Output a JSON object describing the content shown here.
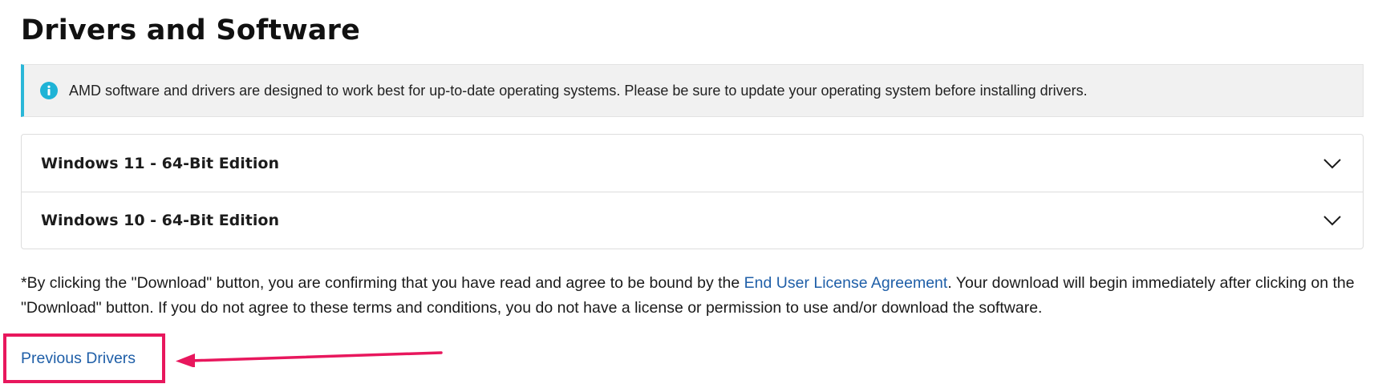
{
  "page": {
    "title": "Drivers and Software"
  },
  "info_banner": {
    "icon": "info-icon",
    "text": "AMD software and drivers are designed to work best for up-to-date operating systems. Please be sure to update your operating system before installing drivers."
  },
  "accordion": {
    "items": [
      {
        "label": "Windows 11 - 64-Bit Edition",
        "icon": "chevron-down-icon",
        "expanded": false
      },
      {
        "label": "Windows 10 - 64-Bit Edition",
        "icon": "chevron-down-icon",
        "expanded": false
      }
    ]
  },
  "disclaimer": {
    "before_link": "*By clicking the \"Download\" button, you are confirming that you have read and agree to be bound by the ",
    "link_text": "End User License Agreement",
    "after_link": ". Your download will begin immediately after clicking on the \"Download\" button. If you do not agree to these terms and conditions, you do not have a license or permission to use and/or download the software."
  },
  "previous_drivers": {
    "label": "Previous Drivers"
  },
  "colors": {
    "info_accent": "#2ab7d8",
    "link": "#1f5fa8",
    "annotation": "#e8175d"
  }
}
